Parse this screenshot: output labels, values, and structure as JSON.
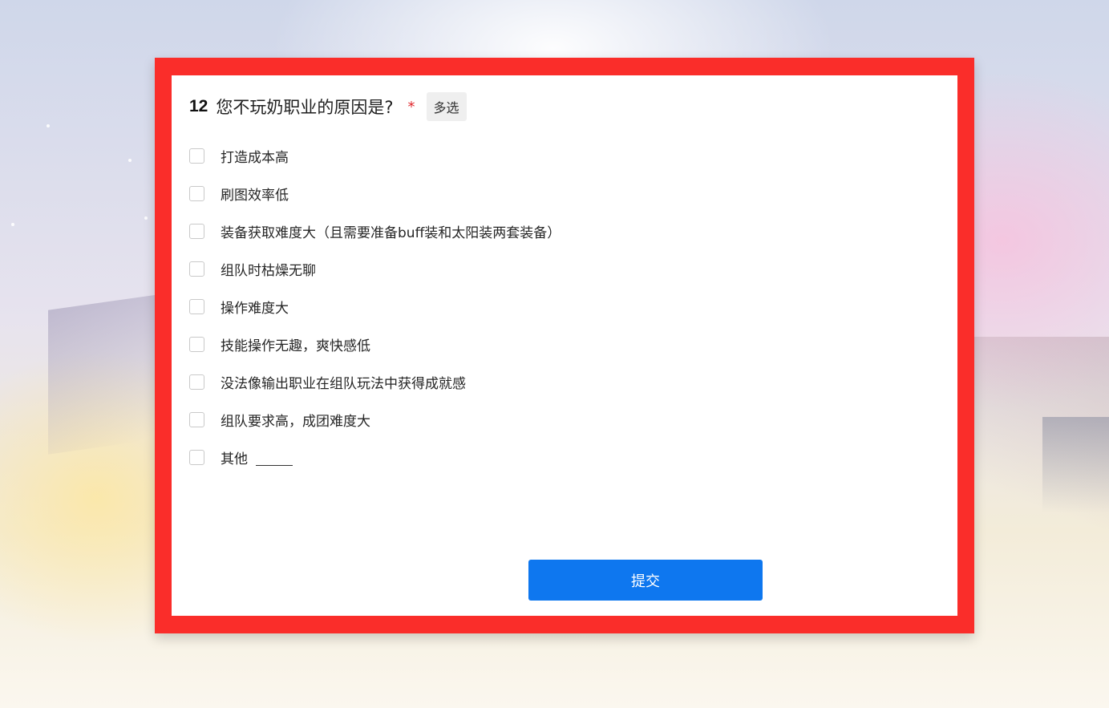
{
  "question": {
    "number": "12",
    "text": "您不玩奶职业的原因是?",
    "required_mark": "*",
    "type_tag": "多选"
  },
  "options": [
    {
      "label": "打造成本高",
      "checked": false
    },
    {
      "label": "刷图效率低",
      "checked": false
    },
    {
      "label": "装备获取难度大（且需要准备buff装和太阳装两套装备）",
      "checked": false
    },
    {
      "label": "组队时枯燥无聊",
      "checked": false
    },
    {
      "label": "操作难度大",
      "checked": false
    },
    {
      "label": "技能操作无趣，爽快感低",
      "checked": false
    },
    {
      "label": "没法像输出职业在组队玩法中获得成就感",
      "checked": false
    },
    {
      "label": "组队要求高，成团难度大",
      "checked": false
    },
    {
      "label": "其他",
      "checked": false,
      "has_text_input": true,
      "text_value": ""
    }
  ],
  "submit_label": "提交",
  "colors": {
    "frame": "#fa2d2a",
    "submit": "#0e77ef",
    "required": "#e0282e"
  }
}
